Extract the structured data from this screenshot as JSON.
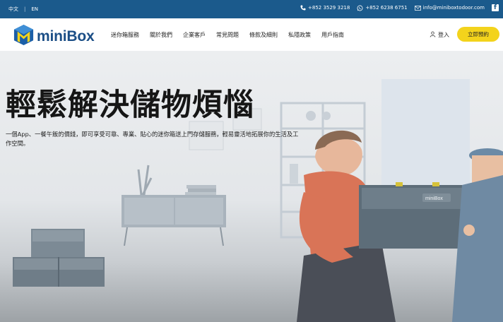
{
  "topbar": {
    "lang_zh": "中文",
    "lang_sep": "|",
    "lang_en": "EN",
    "phone": "+852 3529 3218",
    "whatsapp": "+852 6238 6751",
    "email": "info@miniboxtodoor.com",
    "facebook": "f"
  },
  "logo": {
    "text": "miniBox"
  },
  "nav": {
    "items": [
      "迷你箱服務",
      "關於我們",
      "企業客戶",
      "常見問題",
      "條款及細則",
      "私隱政策",
      "用戶指南"
    ],
    "login": "登入",
    "cta": "立即預約"
  },
  "hero": {
    "title": "輕鬆解決儲物煩惱",
    "subtitle": "一個App、一餐午飯的價錢，即可享受可靠、專業、貼心的迷你箱送上門存儲服務，輕易靈活地拓展你的生活及工作空間。",
    "box_label": "miniBox"
  },
  "colors": {
    "topbar_bg": "#1b5a8c",
    "logo_blue": "#1b4e86",
    "cta_yellow": "#f3d31c"
  },
  "icons": [
    "phone-icon",
    "whatsapp-icon",
    "mail-icon",
    "facebook-icon",
    "user-icon",
    "logo-box-icon"
  ]
}
